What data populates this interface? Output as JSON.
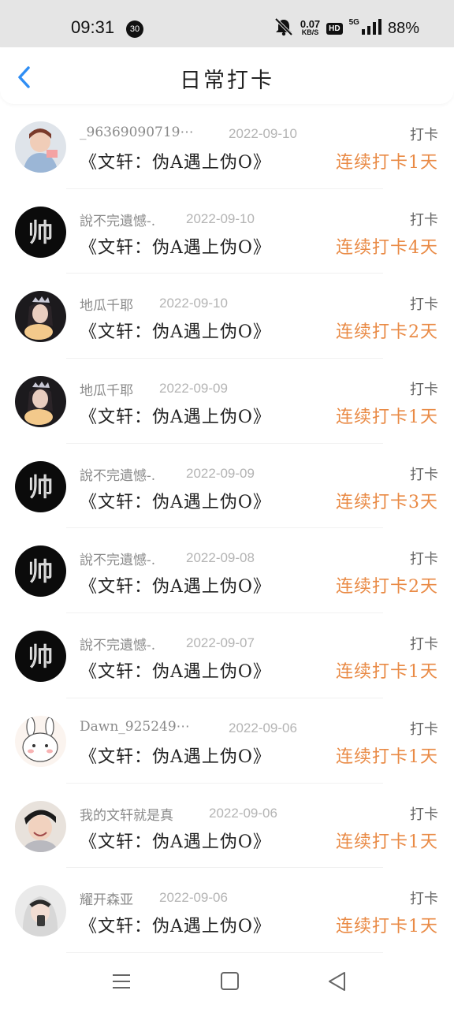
{
  "status_bar": {
    "time": "09:31",
    "notification_count": "30",
    "net_speed_value": "0.07",
    "net_speed_unit": "KB/S",
    "hd": "HD",
    "network": "5G",
    "battery": "88%"
  },
  "header": {
    "title": "日常打卡"
  },
  "entries": [
    {
      "username": "_96369090719⋯",
      "date": "2022-09-10",
      "action": "打卡",
      "book": "《文轩：伪A遇上伪O》",
      "streak": "连续打卡1天",
      "avatar": "girl-photo"
    },
    {
      "username": "說不完遺憾-.",
      "date": "2022-09-10",
      "action": "打卡",
      "book": "《文轩：伪A遇上伪O》",
      "streak": "连续打卡4天",
      "avatar": "black-calligraphy"
    },
    {
      "username": "地瓜千耶",
      "date": "2022-09-10",
      "action": "打卡",
      "book": "《文轩：伪A遇上伪O》",
      "streak": "连续打卡2天",
      "avatar": "crown-girl"
    },
    {
      "username": "地瓜千耶",
      "date": "2022-09-09",
      "action": "打卡",
      "book": "《文轩：伪A遇上伪O》",
      "streak": "连续打卡1天",
      "avatar": "crown-girl"
    },
    {
      "username": "說不完遺憾-.",
      "date": "2022-09-09",
      "action": "打卡",
      "book": "《文轩：伪A遇上伪O》",
      "streak": "连续打卡3天",
      "avatar": "black-calligraphy"
    },
    {
      "username": "說不完遺憾-.",
      "date": "2022-09-08",
      "action": "打卡",
      "book": "《文轩：伪A遇上伪O》",
      "streak": "连续打卡2天",
      "avatar": "black-calligraphy"
    },
    {
      "username": "說不完遺憾-.",
      "date": "2022-09-07",
      "action": "打卡",
      "book": "《文轩：伪A遇上伪O》",
      "streak": "连续打卡1天",
      "avatar": "black-calligraphy"
    },
    {
      "username": "Dawn_925249⋯",
      "date": "2022-09-06",
      "action": "打卡",
      "book": "《文轩：伪A遇上伪O》",
      "streak": "连续打卡1天",
      "avatar": "bunny-cartoon"
    },
    {
      "username": "我的文轩就是真",
      "date": "2022-09-06",
      "action": "打卡",
      "book": "《文轩：伪A遇上伪O》",
      "streak": "连续打卡1天",
      "avatar": "smiling-boy"
    },
    {
      "username": "耀开森亚",
      "date": "2022-09-06",
      "action": "打卡",
      "book": "《文轩：伪A遇上伪O》",
      "streak": "连续打卡1天",
      "avatar": "hooded-person"
    }
  ],
  "colors": {
    "accent": "#e98a45",
    "back_arrow": "#2f8ef4"
  }
}
